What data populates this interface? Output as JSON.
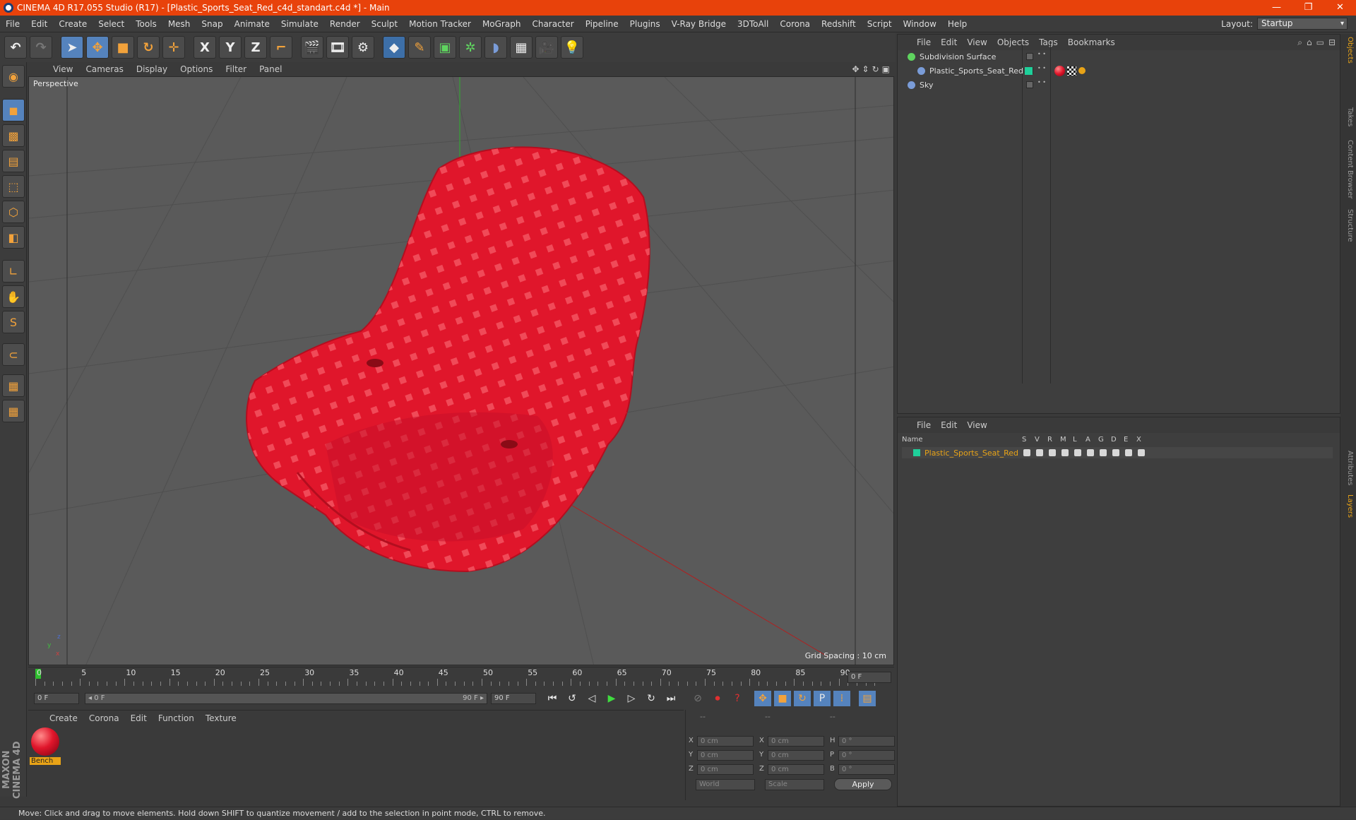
{
  "window": {
    "title": "CINEMA 4D R17.055 Studio (R17) - [Plastic_Sports_Seat_Red_c4d_standart.c4d *] - Main",
    "controls": [
      "—",
      "❐",
      "✕"
    ]
  },
  "menubar": [
    "File",
    "Edit",
    "Create",
    "Select",
    "Tools",
    "Mesh",
    "Snap",
    "Animate",
    "Simulate",
    "Render",
    "Sculpt",
    "Motion Tracker",
    "MoGraph",
    "Character",
    "Pipeline",
    "Plugins",
    "V-Ray Bridge",
    "3DToAll",
    "Corona",
    "Redshift",
    "Script",
    "Window",
    "Help"
  ],
  "layout": {
    "label": "Layout:",
    "value": "Startup"
  },
  "toolbar": {
    "axis_x": "X",
    "axis_y": "Y",
    "axis_z": "Z"
  },
  "viewport": {
    "menu": [
      "View",
      "Cameras",
      "Display",
      "Options",
      "Filter",
      "Panel"
    ],
    "camera_label": "Perspective",
    "grid_spacing": "Grid Spacing : 10 cm",
    "axis_y": "y",
    "axis_z": "z",
    "axis_x": "x"
  },
  "timeline": {
    "ticks": [
      "0",
      "5",
      "10",
      "15",
      "20",
      "25",
      "30",
      "35",
      "40",
      "45",
      "50",
      "55",
      "60",
      "65",
      "70",
      "75",
      "80",
      "85",
      "90"
    ],
    "current_frame": "0 F",
    "start_field": "0 F",
    "range_start": "◂ 0 F",
    "range_end": "90 F ▸",
    "end_field": "90 F"
  },
  "material_manager": {
    "menu": [
      "Create",
      "Corona",
      "Edit",
      "Function",
      "Texture"
    ],
    "materials": [
      {
        "name": "Bench",
        "color": "#e0162b"
      }
    ]
  },
  "coordinates": {
    "header": [
      "--",
      "--",
      "--"
    ],
    "rows": [
      {
        "a": "X",
        "av": "0 cm",
        "b": "X",
        "bv": "0 cm",
        "c": "H",
        "cv": "0 °"
      },
      {
        "a": "Y",
        "av": "0 cm",
        "b": "Y",
        "bv": "0 cm",
        "c": "P",
        "cv": "0 °"
      },
      {
        "a": "Z",
        "av": "0 cm",
        "b": "Z",
        "bv": "0 cm",
        "c": "B",
        "cv": "0 °"
      }
    ],
    "world": "World",
    "scale": "Scale",
    "apply": "Apply"
  },
  "object_manager": {
    "menu": [
      "File",
      "Edit",
      "View",
      "Objects",
      "Tags",
      "Bookmarks"
    ],
    "objects": [
      {
        "name": "Subdivision Surface",
        "indent": 0
      },
      {
        "name": "Plastic_Sports_Seat_Red",
        "indent": 1
      },
      {
        "name": "Sky",
        "indent": 0
      }
    ]
  },
  "layer_manager": {
    "menu": [
      "File",
      "Edit",
      "View"
    ],
    "columns": [
      "Name",
      "S",
      "V",
      "R",
      "M",
      "L",
      "A",
      "G",
      "D",
      "E",
      "X"
    ],
    "layers": [
      {
        "name": "Plastic_Sports_Seat_Red",
        "color": "#e8a317"
      }
    ]
  },
  "side_tabs": [
    "Objects",
    "Takes",
    "Content Browser",
    "Structure",
    "Attributes",
    "Layers"
  ],
  "status": "Move: Click and drag to move elements. Hold down SHIFT to quantize movement / add to the selection in point mode, CTRL to remove.",
  "colors": {
    "accent": "#e8420b",
    "seat": "#e0162b",
    "selection": "#e8a317"
  }
}
